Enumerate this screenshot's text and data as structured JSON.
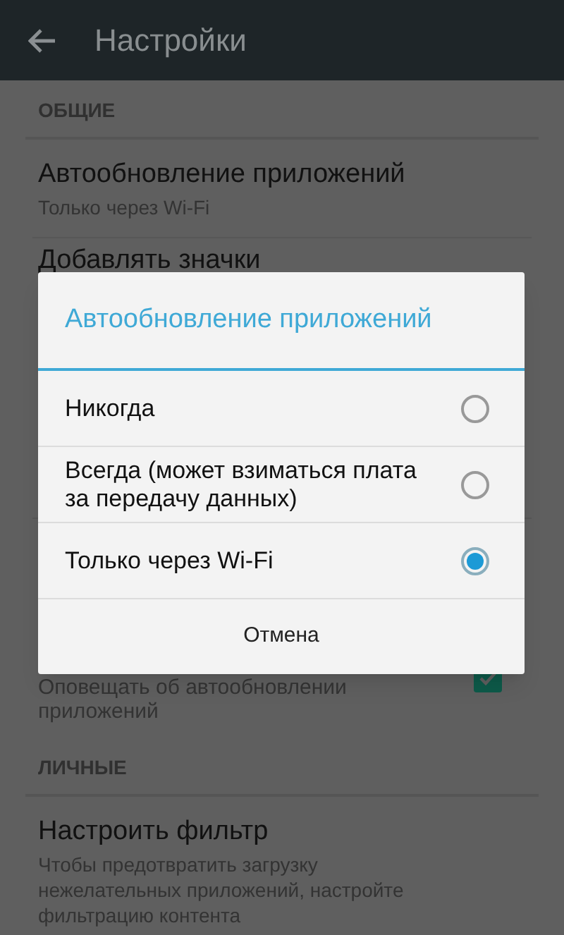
{
  "app_bar": {
    "title": "Настройки"
  },
  "background": {
    "sections": [
      {
        "label": "ОБЩИЕ",
        "items": [
          {
            "kind": "text",
            "title": "Автообновление приложений",
            "subtitle": "Только через Wi-Fi"
          },
          {
            "kind": "title_only",
            "title": "Добавлять значки"
          },
          {
            "kind": "checkbox",
            "subtitle": "Оповещать об автообновлении приложений",
            "checked": true
          }
        ]
      },
      {
        "label": "ЛИЧНЫЕ",
        "items": [
          {
            "kind": "text",
            "title": "Настроить фильтр",
            "subtitle": "Чтобы предотвратить загрузку нежелательных приложений, настройте фильтрацию контента"
          }
        ]
      }
    ]
  },
  "dialog": {
    "title": "Автообновление приложений",
    "options": [
      {
        "label": "Никогда",
        "selected": false
      },
      {
        "label": "Всегда (может взиматься плата за передачу данных)",
        "selected": false
      },
      {
        "label": "Только через Wi-Fi",
        "selected": true
      }
    ],
    "cancel": "Отмена"
  }
}
